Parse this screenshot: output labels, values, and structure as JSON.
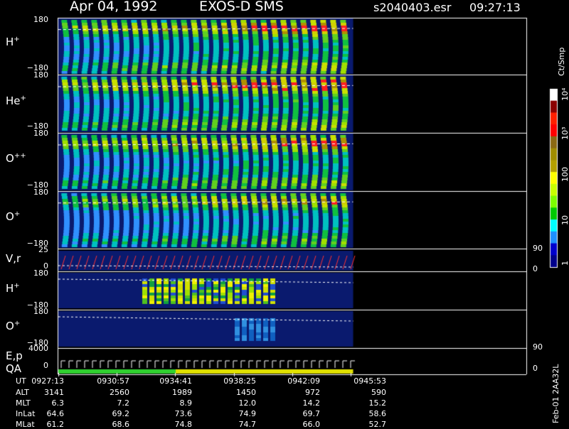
{
  "header": {
    "date": "Apr 04, 1992",
    "instrument": "EXOS-D SMS",
    "file": "s2040403.esr",
    "time": "09:27:13"
  },
  "panels": [
    {
      "id": "hplus",
      "label": "H",
      "sup": "+",
      "ymax": "180",
      "ymin": "−180"
    },
    {
      "id": "heplus",
      "label": "He",
      "sup": "+",
      "ymax": "180",
      "ymin": "−180"
    },
    {
      "id": "oplusplus",
      "label": "O",
      "sup": "++",
      "ymax": "180",
      "ymin": "−180"
    },
    {
      "id": "oplus",
      "label": "O",
      "sup": "+",
      "ymax": "180",
      "ymin": "−180"
    },
    {
      "id": "vr",
      "label": "V,r",
      "sup": "",
      "ymax": "25",
      "ymin": "0",
      "rmax": "90",
      "rmin": "0"
    },
    {
      "id": "hplus2",
      "label": "H",
      "sup": "+",
      "ymax": "180",
      "ymin": "−180"
    },
    {
      "id": "oplus2",
      "label": "O",
      "sup": "+",
      "ymax": "180",
      "ymin": "−180"
    },
    {
      "id": "ep",
      "label": "E,p",
      "sup": "",
      "ymax": "4000",
      "ymin": "0",
      "rmax": "90",
      "rmin": "0"
    }
  ],
  "qa_label": "QA",
  "colorbar": {
    "units": "Ct/Smp",
    "tick_labels": [
      "1",
      "10",
      "100",
      "10³",
      "10⁴"
    ],
    "colors": [
      "#00008b",
      "#0000cd",
      "#1e90ff",
      "#00ffff",
      "#00c800",
      "#7cfc00",
      "#c8ff00",
      "#ffff00",
      "#b4a000",
      "#a08c00",
      "#8b6914",
      "#ff0000",
      "#ff2000",
      "#8b0000",
      "#ffffff"
    ]
  },
  "footer_note": "Feb-01 2AA32L",
  "ephemeris": {
    "rows": [
      {
        "name": "UT",
        "values": [
          "0927:13",
          "0930:57",
          "0934:41",
          "0938:25",
          "0942:09",
          "0945:53"
        ]
      },
      {
        "name": "ALT",
        "values": [
          "3141",
          "2560",
          "1989",
          "1450",
          "972",
          "590"
        ]
      },
      {
        "name": "MLT",
        "values": [
          "6.3",
          "7.2",
          "8.9",
          "12.0",
          "14.2",
          "15.2"
        ]
      },
      {
        "name": "InLat",
        "values": [
          "64.6",
          "69.2",
          "73.6",
          "74.9",
          "69.7",
          "58.6"
        ]
      },
      {
        "name": "MLat",
        "values": [
          "61.2",
          "68.6",
          "74.8",
          "74.7",
          "66.0",
          "52.7"
        ]
      }
    ]
  },
  "chart_data": {
    "type": "heatmap",
    "title": "Apr 04, 1992   EXOS-D SMS",
    "x_ticks_ut": [
      "0927:13",
      "0930:57",
      "0934:41",
      "0938:25",
      "0942:09",
      "0945:53"
    ],
    "ion_panels": [
      "H+",
      "He+",
      "O++",
      "O+"
    ],
    "pitch_angle_range": [
      -180,
      180
    ],
    "colorscale_units": "Ct/Smp",
    "colorscale_range": [
      1,
      10000
    ],
    "log_scale": true,
    "data_end_fraction": 0.99
  }
}
